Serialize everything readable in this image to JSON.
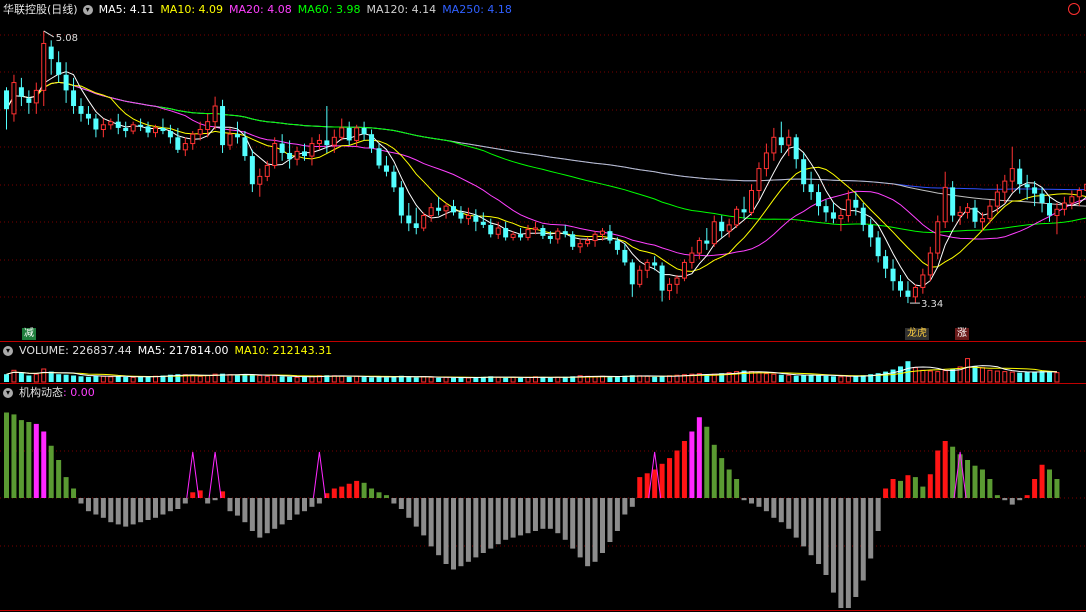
{
  "header": {
    "stock_title": "华联控股(日线)",
    "ma5": "MA5: 4.11",
    "ma10": "MA10: 4.09",
    "ma20": "MA20: 4.08",
    "ma60": "MA60: 3.98",
    "ma120": "MA120: 4.14",
    "ma250": "MA250: 4.18"
  },
  "volume_header": {
    "volume": "VOLUME: 226837.44",
    "ma5": "MA5: 217814.00",
    "ma10": "MA10: 212143.31"
  },
  "indicator_header": {
    "name": "机构动态",
    "value": ": 0.00"
  },
  "markers": {
    "reduce": "减",
    "dragon": "龙虎",
    "rise": "涨"
  },
  "colors": {
    "up": "#ff3232",
    "down": "#54ffff",
    "ma5": "#ffffff",
    "ma10": "#ffff00",
    "ma20": "#ff40ff",
    "ma60": "#00ff00",
    "ma120": "#c0c0c0",
    "ma250": "#3050ff",
    "ind_green": "#5a9a32",
    "ind_magenta": "#ff28ff",
    "ind_red": "#ff1414",
    "ind_gray": "#8c8c8c"
  },
  "chart_data": [
    {
      "type": "candlestick",
      "title": "华联控股(日线)",
      "ylim": [
        3.2,
        5.15
      ],
      "annotations": [
        {
          "label": "5.08",
          "value": 5.08
        },
        {
          "label": "3.34",
          "value": 3.34
        }
      ],
      "ohlc": [
        [
          4.7,
          4.72,
          4.45,
          4.58
        ],
        [
          4.55,
          4.8,
          4.5,
          4.75
        ],
        [
          4.72,
          4.78,
          4.6,
          4.66
        ],
        [
          4.65,
          4.7,
          4.55,
          4.62
        ],
        [
          4.62,
          4.75,
          4.55,
          4.7
        ],
        [
          4.7,
          5.08,
          4.6,
          5.0
        ],
        [
          4.98,
          5.02,
          4.8,
          4.9
        ],
        [
          4.88,
          4.95,
          4.75,
          4.8
        ],
        [
          4.8,
          4.88,
          4.62,
          4.7
        ],
        [
          4.7,
          4.78,
          4.55,
          4.6
        ],
        [
          4.6,
          4.65,
          4.5,
          4.55
        ],
        [
          4.55,
          4.6,
          4.48,
          4.52
        ],
        [
          4.52,
          4.55,
          4.4,
          4.45
        ],
        [
          4.45,
          4.52,
          4.4,
          4.48
        ],
        [
          4.48,
          4.52,
          4.45,
          4.5
        ],
        [
          4.5,
          4.55,
          4.42,
          4.46
        ],
        [
          4.46,
          4.5,
          4.4,
          4.44
        ],
        [
          4.44,
          4.5,
          4.42,
          4.48
        ],
        [
          4.48,
          4.52,
          4.44,
          4.47
        ],
        [
          4.47,
          4.5,
          4.4,
          4.43
        ],
        [
          4.43,
          4.48,
          4.4,
          4.46
        ],
        [
          4.46,
          4.52,
          4.42,
          4.44
        ],
        [
          4.44,
          4.48,
          4.36,
          4.4
        ],
        [
          4.4,
          4.46,
          4.3,
          4.32
        ],
        [
          4.32,
          4.4,
          4.28,
          4.36
        ],
        [
          4.36,
          4.44,
          4.32,
          4.42
        ],
        [
          4.42,
          4.5,
          4.38,
          4.45
        ],
        [
          4.45,
          4.55,
          4.4,
          4.5
        ],
        [
          4.5,
          4.66,
          4.45,
          4.6
        ],
        [
          4.6,
          4.64,
          4.3,
          4.35
        ],
        [
          4.35,
          4.46,
          4.32,
          4.42
        ],
        [
          4.42,
          4.5,
          4.36,
          4.4
        ],
        [
          4.4,
          4.44,
          4.25,
          4.28
        ],
        [
          4.28,
          4.32,
          4.05,
          4.1
        ],
        [
          4.1,
          4.2,
          4.02,
          4.15
        ],
        [
          4.15,
          4.25,
          4.12,
          4.22
        ],
        [
          4.22,
          4.4,
          4.2,
          4.36
        ],
        [
          4.36,
          4.42,
          4.25,
          4.3
        ],
        [
          4.3,
          4.38,
          4.2,
          4.26
        ],
        [
          4.26,
          4.34,
          4.22,
          4.31
        ],
        [
          4.31,
          4.36,
          4.25,
          4.28
        ],
        [
          4.28,
          4.4,
          4.22,
          4.36
        ],
        [
          4.36,
          4.42,
          4.32,
          4.38
        ],
        [
          4.38,
          4.6,
          4.3,
          4.35
        ],
        [
          4.35,
          4.45,
          4.3,
          4.4
        ],
        [
          4.4,
          4.52,
          4.38,
          4.46
        ],
        [
          4.46,
          4.5,
          4.35,
          4.38
        ],
        [
          4.38,
          4.48,
          4.34,
          4.46
        ],
        [
          4.46,
          4.5,
          4.38,
          4.42
        ],
        [
          4.42,
          4.45,
          4.3,
          4.33
        ],
        [
          4.33,
          4.36,
          4.2,
          4.22
        ],
        [
          4.22,
          4.28,
          4.15,
          4.18
        ],
        [
          4.18,
          4.22,
          4.05,
          4.08
        ],
        [
          4.08,
          4.12,
          3.85,
          3.9
        ],
        [
          3.9,
          3.98,
          3.8,
          3.85
        ],
        [
          3.85,
          3.95,
          3.78,
          3.82
        ],
        [
          3.82,
          3.92,
          3.8,
          3.9
        ],
        [
          3.9,
          3.98,
          3.86,
          3.95
        ],
        [
          3.95,
          4.02,
          3.9,
          3.93
        ],
        [
          3.93,
          3.98,
          3.88,
          3.96
        ],
        [
          3.96,
          4.0,
          3.9,
          3.92
        ],
        [
          3.92,
          3.96,
          3.85,
          3.88
        ],
        [
          3.88,
          3.95,
          3.84,
          3.9
        ],
        [
          3.9,
          3.94,
          3.8,
          3.86
        ],
        [
          3.86,
          3.92,
          3.82,
          3.84
        ],
        [
          3.84,
          3.88,
          3.76,
          3.78
        ],
        [
          3.78,
          3.86,
          3.75,
          3.82
        ],
        [
          3.82,
          3.86,
          3.74,
          3.76
        ],
        [
          3.76,
          3.8,
          3.74,
          3.78
        ],
        [
          3.78,
          3.82,
          3.74,
          3.76
        ],
        [
          3.76,
          3.84,
          3.74,
          3.81
        ],
        [
          3.81,
          3.86,
          3.78,
          3.82
        ],
        [
          3.82,
          3.84,
          3.75,
          3.77
        ],
        [
          3.77,
          3.8,
          3.72,
          3.75
        ],
        [
          3.75,
          3.82,
          3.72,
          3.8
        ],
        [
          3.8,
          3.84,
          3.76,
          3.78
        ],
        [
          3.78,
          3.8,
          3.68,
          3.7
        ],
        [
          3.7,
          3.75,
          3.66,
          3.72
        ],
        [
          3.72,
          3.76,
          3.7,
          3.74
        ],
        [
          3.74,
          3.8,
          3.7,
          3.78
        ],
        [
          3.78,
          3.82,
          3.74,
          3.8
        ],
        [
          3.8,
          3.84,
          3.72,
          3.74
        ],
        [
          3.74,
          3.76,
          3.65,
          3.68
        ],
        [
          3.68,
          3.72,
          3.58,
          3.6
        ],
        [
          3.6,
          3.62,
          3.38,
          3.46
        ],
        [
          3.46,
          3.58,
          3.44,
          3.55
        ],
        [
          3.55,
          3.62,
          3.5,
          3.6
        ],
        [
          3.6,
          3.64,
          3.55,
          3.58
        ],
        [
          3.58,
          3.6,
          3.35,
          3.42
        ],
        [
          3.42,
          3.5,
          3.36,
          3.46
        ],
        [
          3.46,
          3.52,
          3.4,
          3.5
        ],
        [
          3.5,
          3.62,
          3.48,
          3.6
        ],
        [
          3.6,
          3.7,
          3.56,
          3.66
        ],
        [
          3.66,
          3.76,
          3.62,
          3.74
        ],
        [
          3.74,
          3.82,
          3.68,
          3.72
        ],
        [
          3.72,
          3.9,
          3.7,
          3.86
        ],
        [
          3.86,
          3.9,
          3.76,
          3.8
        ],
        [
          3.8,
          3.88,
          3.76,
          3.84
        ],
        [
          3.84,
          3.96,
          3.82,
          3.94
        ],
        [
          3.94,
          4.02,
          3.88,
          3.92
        ],
        [
          3.92,
          4.1,
          3.9,
          4.06
        ],
        [
          4.06,
          4.24,
          4.0,
          4.2
        ],
        [
          4.2,
          4.36,
          4.15,
          4.3
        ],
        [
          4.3,
          4.46,
          4.25,
          4.4
        ],
        [
          4.4,
          4.5,
          4.3,
          4.35
        ],
        [
          4.35,
          4.45,
          4.28,
          4.4
        ],
        [
          4.4,
          4.42,
          4.2,
          4.26
        ],
        [
          4.26,
          4.3,
          4.05,
          4.1
        ],
        [
          4.1,
          4.18,
          4.0,
          4.05
        ],
        [
          4.05,
          4.1,
          3.9,
          3.96
        ],
        [
          3.96,
          4.0,
          3.86,
          3.92
        ],
        [
          3.92,
          3.98,
          3.85,
          3.88
        ],
        [
          3.88,
          3.94,
          3.8,
          3.9
        ],
        [
          3.9,
          4.06,
          3.86,
          4.0
        ],
        [
          4.0,
          4.05,
          3.9,
          3.95
        ],
        [
          3.95,
          3.98,
          3.8,
          3.84
        ],
        [
          3.84,
          3.88,
          3.7,
          3.76
        ],
        [
          3.76,
          3.8,
          3.6,
          3.64
        ],
        [
          3.64,
          3.68,
          3.5,
          3.56
        ],
        [
          3.56,
          3.62,
          3.42,
          3.48
        ],
        [
          3.48,
          3.52,
          3.38,
          3.42
        ],
        [
          3.42,
          3.48,
          3.34,
          3.38
        ],
        [
          3.38,
          3.46,
          3.34,
          3.44
        ],
        [
          3.44,
          3.56,
          3.4,
          3.52
        ],
        [
          3.52,
          3.7,
          3.48,
          3.66
        ],
        [
          3.66,
          3.9,
          3.62,
          3.86
        ],
        [
          3.86,
          4.18,
          3.82,
          4.08
        ],
        [
          4.08,
          4.12,
          3.86,
          3.9
        ],
        [
          3.9,
          3.96,
          3.84,
          3.92
        ],
        [
          3.92,
          3.98,
          3.88,
          3.95
        ],
        [
          3.95,
          4.0,
          3.82,
          3.86
        ],
        [
          3.86,
          3.92,
          3.8,
          3.88
        ],
        [
          3.88,
          4.0,
          3.85,
          3.96
        ],
        [
          3.96,
          4.1,
          3.92,
          4.05
        ],
        [
          4.05,
          4.16,
          3.98,
          4.12
        ],
        [
          4.12,
          4.34,
          4.05,
          4.2
        ],
        [
          4.2,
          4.26,
          4.04,
          4.1
        ],
        [
          4.1,
          4.16,
          4.0,
          4.08
        ],
        [
          4.08,
          4.12,
          3.96,
          4.04
        ],
        [
          4.04,
          4.08,
          3.92,
          3.98
        ],
        [
          3.98,
          4.02,
          3.86,
          3.9
        ],
        [
          3.9,
          3.98,
          3.78,
          3.94
        ],
        [
          3.94,
          4.02,
          3.9,
          3.98
        ],
        [
          3.98,
          4.06,
          3.94,
          4.02
        ],
        [
          4.02,
          4.08,
          3.96,
          4.06
        ],
        [
          4.06,
          4.12,
          4.02,
          4.1
        ],
        [
          4.1,
          4.2,
          4.04,
          4.18
        ]
      ]
    },
    {
      "type": "bar",
      "title": "VOLUME",
      "values": [
        0.3,
        0.45,
        0.35,
        0.25,
        0.3,
        0.5,
        0.4,
        0.3,
        0.28,
        0.25,
        0.22,
        0.2,
        0.25,
        0.22,
        0.2,
        0.22,
        0.2,
        0.18,
        0.22,
        0.2,
        0.22,
        0.25,
        0.28,
        0.3,
        0.28,
        0.25,
        0.22,
        0.25,
        0.3,
        0.32,
        0.28,
        0.26,
        0.3,
        0.28,
        0.25,
        0.22,
        0.24,
        0.22,
        0.2,
        0.18,
        0.2,
        0.22,
        0.24,
        0.26,
        0.24,
        0.22,
        0.2,
        0.22,
        0.2,
        0.18,
        0.2,
        0.18,
        0.22,
        0.24,
        0.2,
        0.18,
        0.2,
        0.18,
        0.16,
        0.18,
        0.16,
        0.18,
        0.16,
        0.18,
        0.2,
        0.22,
        0.18,
        0.16,
        0.18,
        0.16,
        0.18,
        0.2,
        0.18,
        0.16,
        0.18,
        0.2,
        0.22,
        0.24,
        0.22,
        0.2,
        0.22,
        0.2,
        0.22,
        0.24,
        0.26,
        0.24,
        0.22,
        0.2,
        0.22,
        0.24,
        0.26,
        0.28,
        0.3,
        0.32,
        0.28,
        0.3,
        0.34,
        0.36,
        0.4,
        0.44,
        0.4,
        0.36,
        0.32,
        0.3,
        0.28,
        0.26,
        0.24,
        0.26,
        0.28,
        0.26,
        0.24,
        0.22,
        0.2,
        0.22,
        0.24,
        0.26,
        0.3,
        0.34,
        0.4,
        0.48,
        0.6,
        0.8,
        0.55,
        0.45,
        0.42,
        0.4,
        0.44,
        0.5,
        0.58,
        0.9,
        0.62,
        0.55,
        0.45,
        0.42,
        0.4,
        0.38,
        0.36,
        0.38,
        0.4,
        0.42,
        0.38,
        0.36
      ]
    },
    {
      "type": "bar",
      "title": "机构动态",
      "values": [
        0.9,
        0.88,
        0.82,
        0.8,
        0.78,
        0.7,
        0.55,
        0.4,
        0.22,
        0.1,
        -0.05,
        -0.12,
        -0.15,
        -0.18,
        -0.22,
        -0.24,
        -0.26,
        -0.24,
        -0.22,
        -0.2,
        -0.18,
        -0.15,
        -0.12,
        -0.1,
        -0.05,
        0.06,
        0.08,
        -0.05,
        -0.02,
        0.07,
        -0.12,
        -0.16,
        -0.22,
        -0.3,
        -0.36,
        -0.32,
        -0.28,
        -0.24,
        -0.2,
        -0.15,
        -0.12,
        -0.08,
        -0.05,
        0.05,
        0.1,
        0.12,
        0.15,
        0.18,
        0.16,
        0.1,
        0.06,
        0.03,
        -0.05,
        -0.1,
        -0.18,
        -0.26,
        -0.34,
        -0.44,
        -0.52,
        -0.6,
        -0.65,
        -0.62,
        -0.58,
        -0.54,
        -0.5,
        -0.46,
        -0.42,
        -0.38,
        -0.36,
        -0.34,
        -0.32,
        -0.3,
        -0.28,
        -0.28,
        -0.32,
        -0.38,
        -0.46,
        -0.54,
        -0.62,
        -0.58,
        -0.5,
        -0.4,
        -0.3,
        -0.15,
        -0.08,
        0.22,
        0.26,
        0.3,
        0.36,
        0.42,
        0.5,
        0.6,
        0.7,
        0.85,
        0.75,
        0.56,
        0.42,
        0.3,
        0.2,
        -0.02,
        -0.05,
        -0.08,
        -0.12,
        -0.18,
        -0.22,
        -0.28,
        -0.36,
        -0.44,
        -0.52,
        -0.6,
        -0.7,
        -0.86,
        -1.0,
        -1.0,
        -0.9,
        -0.75,
        -0.55,
        -0.3,
        0.1,
        0.2,
        0.18,
        0.24,
        0.22,
        0.12,
        0.25,
        0.5,
        0.6,
        0.54,
        0.46,
        0.4,
        0.34,
        0.3,
        0.2,
        0.03,
        -0.02,
        -0.06,
        -0.02,
        0.03,
        0.2,
        0.35,
        0.3,
        0.2
      ],
      "signals": [
        25,
        28,
        42,
        87,
        128,
        148
      ]
    }
  ]
}
